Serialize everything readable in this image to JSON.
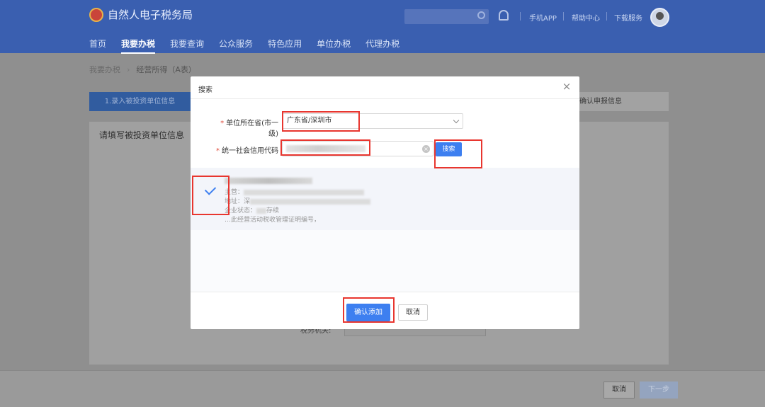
{
  "app": {
    "title": "自然人电子税务局"
  },
  "topbar": {
    "links": [
      "手机APP",
      "帮助中心",
      "下载服务"
    ],
    "search_placeholder": ""
  },
  "nav": {
    "items": [
      "首页",
      "我要办税",
      "我要查询",
      "公众服务",
      "特色应用",
      "单位办税",
      "代理办税"
    ],
    "active_index": 1
  },
  "breadcrumb": {
    "parent": "我要办税",
    "current": "经营所得（A表）"
  },
  "steps": {
    "step1": "1.录入被投资单位信息",
    "step3": "确认申报信息"
  },
  "panel": {
    "title": "请填写被投资单位信息",
    "field_label": "税务机关:",
    "field_value": ""
  },
  "footer": {
    "cancel": "取消",
    "next": "下一步"
  },
  "modal": {
    "title": "搜索",
    "close": "×",
    "region_label": "单位所在省(市一级)",
    "region_value": "广东省/深圳市",
    "code_label": "统一社会信用代码",
    "code_value": "",
    "clear_icon": "×",
    "search_button": "搜索",
    "result": {
      "line1_prefix": "主营：",
      "line2_prefix": "地址：深",
      "line3_prefix": "企业状态：",
      "line3_suffix": "存续",
      "line4": "…此经营活动税收管理证明编号，"
    },
    "confirm_button": "确认添加",
    "cancel_button": "取消"
  },
  "colors": {
    "accent": "#3d7ff0",
    "header": "#3a5fb0",
    "annotation": "#e8362f"
  }
}
